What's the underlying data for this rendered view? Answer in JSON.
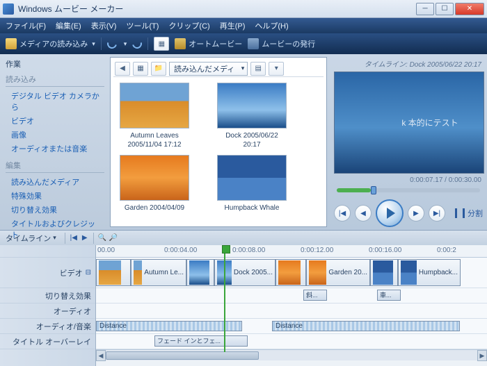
{
  "window": {
    "title": "Windows ムービー メーカー"
  },
  "menu": {
    "file": "ファイル(F)",
    "edit": "編集(E)",
    "view": "表示(V)",
    "tools": "ツール(T)",
    "clip": "クリップ(C)",
    "play": "再生(P)",
    "help": "ヘルプ(H)"
  },
  "toolbar": {
    "import": "メディアの読み込み",
    "automovie": "オートムービー",
    "publish": "ムービーの発行"
  },
  "sidebar": {
    "tasks": "作業",
    "sect_import": "読み込み",
    "links_import": [
      "デジタル ビデオ カメラから",
      "ビデオ",
      "画像",
      "オーディオまたは音楽"
    ],
    "sect_edit": "編集",
    "links_edit": [
      "読み込んだメディア",
      "特殊効果",
      "切り替え効果",
      "タイトルおよびクレジット"
    ]
  },
  "collection": {
    "combo": "読み込んだメディ",
    "items": [
      {
        "label": "Autumn Leaves",
        "sub": "2005/11/04 17:12"
      },
      {
        "label": "Dock 2005/06/22",
        "sub": "20:17"
      },
      {
        "label": "Garden 2004/04/09",
        "sub": ""
      },
      {
        "label": "Humpback Whale",
        "sub": ""
      }
    ]
  },
  "preview": {
    "title": "タイムライン: Dock 2005/06/22 20:17",
    "caption": "k 本的にテスト",
    "time": "0:00:07.17 / 0:00:30.00",
    "split": "分割"
  },
  "timeline": {
    "label": "タイムライン",
    "ruler": [
      "00.00",
      "0:00:04.00",
      "0:00:08.00",
      "0:00:12.00",
      "0:00:16.00",
      "0:00:2"
    ],
    "tracks": {
      "video": "ビデオ",
      "transition": "切り替え効果",
      "audio": "オーディオ",
      "audio_music": "オーディオ/音楽",
      "title_overlay": "タイトル オーバーレイ"
    },
    "video_clips": [
      "Autumn Le...",
      "",
      "Dock 2005...",
      "",
      "Garden 20...",
      "",
      "Humpback..."
    ],
    "transitions": [
      "斜...",
      "車..."
    ],
    "audio_music_clips": [
      "Distance",
      "Distance"
    ],
    "title_clips": [
      "フェード インとフェ..."
    ]
  }
}
